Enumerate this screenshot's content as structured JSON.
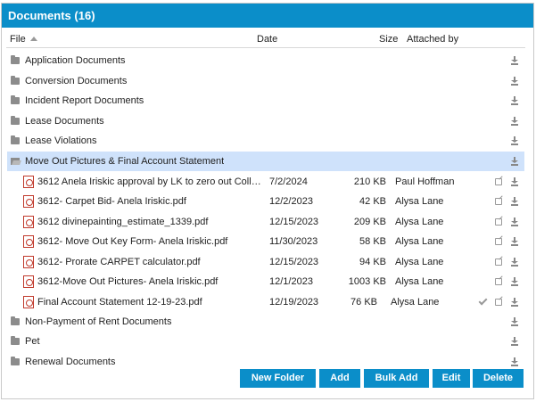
{
  "panel": {
    "title": "Documents (16)"
  },
  "columns": {
    "file": "File",
    "date": "Date",
    "size": "Size",
    "attached_by": "Attached by"
  },
  "folders_top": [
    {
      "name": "Application Documents"
    },
    {
      "name": "Conversion Documents"
    },
    {
      "name": "Incident Report Documents"
    },
    {
      "name": "Lease Documents"
    },
    {
      "name": "Lease Violations"
    }
  ],
  "open_folder": {
    "name": "Move Out Pictures & Final Account Statement",
    "selected": true
  },
  "files": [
    {
      "name": "3612 Anela Iriskic approval by LK to zero out Collections",
      "date": "7/2/2024",
      "size": "210 KB",
      "attached_by": "Paul Hoffman"
    },
    {
      "name": "3612- Carpet Bid- Anela Iriskic.pdf",
      "date": "12/2/2023",
      "size": "42 KB",
      "attached_by": "Alysa Lane"
    },
    {
      "name": "3612 divinepainting_estimate_1339.pdf",
      "date": "12/15/2023",
      "size": "209 KB",
      "attached_by": "Alysa Lane"
    },
    {
      "name": "3612- Move Out Key Form- Anela Iriskic.pdf",
      "date": "11/30/2023",
      "size": "58 KB",
      "attached_by": "Alysa Lane"
    },
    {
      "name": "3612- Prorate CARPET calculator.pdf",
      "date": "12/15/2023",
      "size": "94 KB",
      "attached_by": "Alysa Lane"
    },
    {
      "name": "3612-Move Out Pictures- Anela Iriskic.pdf",
      "date": "12/1/2023",
      "size": "1003 KB",
      "attached_by": "Alysa Lane"
    },
    {
      "name": "Final Account Statement 12-19-23.pdf",
      "date": "12/19/2023",
      "size": "76 KB",
      "attached_by": "Alysa Lane",
      "checked": true
    }
  ],
  "folders_bottom": [
    {
      "name": "Non-Payment of Rent Documents"
    },
    {
      "name": "Pet"
    },
    {
      "name": "Renewal Documents"
    }
  ],
  "buttons": {
    "new_folder": "New Folder",
    "add": "Add",
    "bulk_add": "Bulk Add",
    "edit": "Edit",
    "delete": "Delete"
  },
  "colors": {
    "header": "#0b8ec9",
    "selected_row": "#cfe2fb",
    "pdf_icon": "#c0392b"
  }
}
